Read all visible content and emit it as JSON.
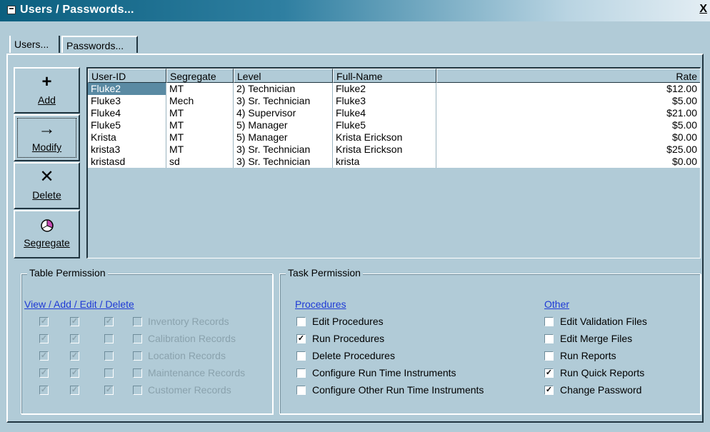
{
  "window": {
    "title": "Users / Passwords...",
    "close_label": "X"
  },
  "tabs": [
    {
      "label": "Users..."
    },
    {
      "label": "Passwords..."
    }
  ],
  "toolbar": {
    "add": {
      "label": "Add",
      "icon": "plus-icon"
    },
    "modify": {
      "label": "Modify",
      "icon": "arrow-right-icon"
    },
    "delete": {
      "label": "Delete",
      "icon": "x-icon"
    },
    "segregate": {
      "label": "Segregate",
      "icon": "pie-chart-icon"
    }
  },
  "users_grid": {
    "columns": [
      "User-ID",
      "Segregate",
      "Level",
      "Full-Name",
      "Rate"
    ],
    "rows": [
      [
        "Fluke2",
        "MT",
        "2) Technician",
        "Fluke2",
        "$12.00"
      ],
      [
        "Fluke3",
        "Mech",
        "3) Sr. Technician",
        "Fluke3",
        "$5.00"
      ],
      [
        "Fluke4",
        "MT",
        "4) Supervisor",
        "Fluke4",
        "$21.00"
      ],
      [
        "Fluke5",
        "MT",
        "5) Manager",
        "Fluke5",
        "$5.00"
      ],
      [
        "Krista",
        "MT",
        "5) Manager",
        "Krista Erickson",
        "$0.00"
      ],
      [
        "krista3",
        "MT",
        "3) Sr. Technician",
        "Krista Erickson",
        "$25.00"
      ],
      [
        "kristasd",
        "sd",
        "3) Sr. Technician",
        "krista",
        "$0.00"
      ]
    ],
    "selected_row": 0
  },
  "table_permission": {
    "legend": "Table Permission",
    "header": "View / Add / Edit / Delete",
    "rows": [
      {
        "label": "Inventory Records",
        "view": true,
        "add": true,
        "edit": true,
        "delete": false
      },
      {
        "label": "Calibration Records",
        "view": true,
        "add": true,
        "edit": false,
        "delete": false
      },
      {
        "label": "Location Records",
        "view": true,
        "add": true,
        "edit": false,
        "delete": false
      },
      {
        "label": "Maintenance Records",
        "view": true,
        "add": true,
        "edit": false,
        "delete": false
      },
      {
        "label": "Customer Records",
        "view": true,
        "add": true,
        "edit": true,
        "delete": false
      }
    ]
  },
  "task_permission": {
    "legend": "Task Permission",
    "procedures": {
      "header": "Procedures",
      "items": [
        {
          "label": "Edit Procedures",
          "checked": false
        },
        {
          "label": "Run Procedures",
          "checked": true
        },
        {
          "label": "Delete Procedures",
          "checked": false
        },
        {
          "label": "Configure Run Time Instruments",
          "checked": false
        },
        {
          "label": "Configure Other Run Time Instruments",
          "checked": false
        }
      ]
    },
    "other": {
      "header": "Other",
      "items": [
        {
          "label": "Edit Validation Files",
          "checked": false
        },
        {
          "label": "Edit Merge Files",
          "checked": false
        },
        {
          "label": "Run Reports",
          "checked": false
        },
        {
          "label": "Run Quick Reports",
          "checked": true
        },
        {
          "label": "Change Password",
          "checked": true
        }
      ]
    }
  }
}
